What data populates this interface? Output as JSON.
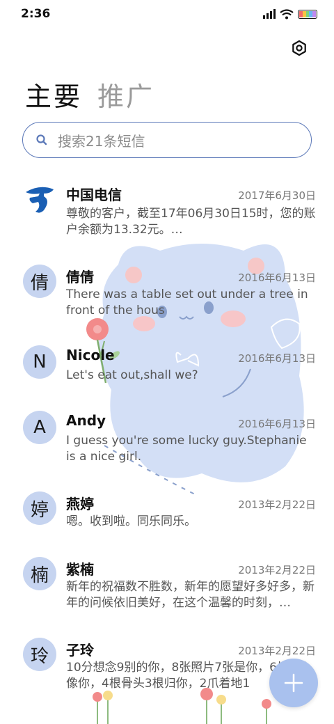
{
  "status_bar": {
    "time": "2:36"
  },
  "tabs": [
    {
      "label": "主要",
      "active": true
    },
    {
      "label": "推广",
      "active": false
    }
  ],
  "search": {
    "placeholder": "搜索21条短信"
  },
  "conversations": [
    {
      "avatar": "",
      "name": "中国电信",
      "date": "2017年6月30日",
      "preview": "尊敬的客户，截至17年06月30日15时，您的账户余额为13.32元。…"
    },
    {
      "avatar": "倩",
      "name": "倩倩",
      "date": "2016年6月13日",
      "preview": "There was a table set out under a tree in front of the hous"
    },
    {
      "avatar": "N",
      "name": "Nicole",
      "date": "2016年6月13日",
      "preview": "Let's eat out,shall we?"
    },
    {
      "avatar": "A",
      "name": "Andy",
      "date": "2016年6月13日",
      "preview": "I guess you're some lucky guy.Stephanie is a nice girl."
    },
    {
      "avatar": "婷",
      "name": "燕婷",
      "date": "2013年2月22日",
      "preview": "嗯。收到啦。同乐同乐。"
    },
    {
      "avatar": "楠",
      "name": "紫楠",
      "date": "2013年2月22日",
      "preview": "新年的祝福数不胜数，新年的愿望好多好多，新年的问候依旧美好，在这个温馨的时刻，…"
    },
    {
      "avatar": "玲",
      "name": "子玲",
      "date": "2013年2月22日",
      "preview": "10分想念9别的你，8张照片7张是你，6片5只像你，4根骨头3根归你，2爪着地1"
    }
  ],
  "colors": {
    "accent": "#5b78b8",
    "avatar_bg": "#c6d4f0",
    "fab_bg": "#a9c1ee",
    "telecom_blue": "#1a5fb4"
  },
  "icons": {
    "settings": "settings-icon",
    "search": "search-icon",
    "compose": "plus-icon"
  }
}
